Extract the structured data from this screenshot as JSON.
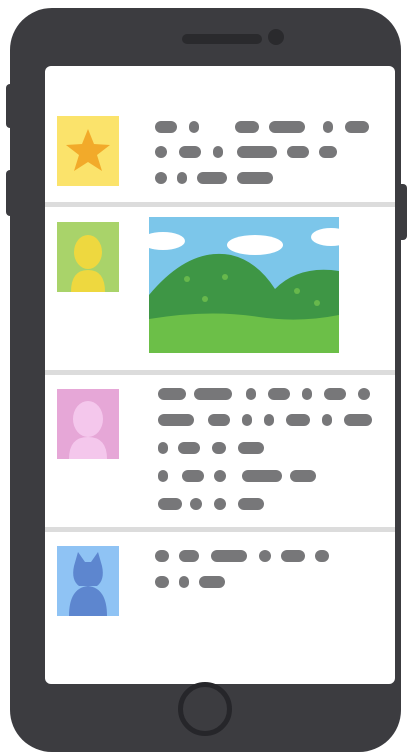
{
  "device": {
    "frame_color": "#3c3c40",
    "screen_color": "#ffffff"
  },
  "feed": {
    "posts": [
      {
        "avatar_icon": "star-icon",
        "avatar_bg": "#fbe36b",
        "text_lines": 3
      },
      {
        "avatar_icon": "person-icon",
        "avatar_bg": "#a9d36a",
        "image": "landscape-photo"
      },
      {
        "avatar_icon": "person-icon",
        "avatar_bg": "#e6a7d7",
        "text_lines": 5
      },
      {
        "avatar_icon": "cat-icon",
        "avatar_bg": "#8fc3f4",
        "text_lines": 2
      }
    ],
    "text_color": "#777779",
    "separator_color": "#dcdcdc"
  }
}
